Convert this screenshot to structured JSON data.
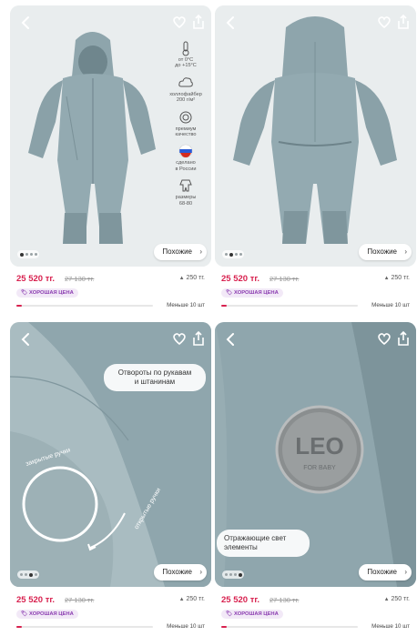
{
  "common": {
    "similar_label": "Похожие",
    "chevron": "›",
    "price": "25 520 тг.",
    "old_price": "27 130 тг.",
    "price_delta": "250 тг.",
    "delta_arrow": "▲",
    "badge": "ХОРОШАЯ ЦЕНА",
    "stock_text": "Меньше 10 шт",
    "stock_level_fraction": 0.04
  },
  "features": [
    {
      "icon": "thermometer-icon",
      "text": "от 0°С\nдо +15°С"
    },
    {
      "icon": "cloud-icon",
      "text": "холлофайбер\n200 г/м²"
    },
    {
      "icon": "quality-medal-icon",
      "text": "премиум\nкачество"
    },
    {
      "icon": "russian-flag-icon",
      "text": "сделано\nв России"
    },
    {
      "icon": "romper-size-icon",
      "text": "размеры\n68-80"
    }
  ],
  "callouts": {
    "cuffs": "Отвороты по рукавам\nи штанинам",
    "reflective": "Отражающие свет\nэлементы"
  },
  "overlay_labels": {
    "closed_hands": "закрытые ручки",
    "open_hands": "открытые ручки",
    "patch_logo": "LEO",
    "patch_sub": "FOR BABY"
  },
  "colors": {
    "price_red": "#d8214f",
    "badge_purple": "#8a3bb0",
    "fabric_blue": "#8fa6ad",
    "photo_bg": "#e9edee"
  }
}
